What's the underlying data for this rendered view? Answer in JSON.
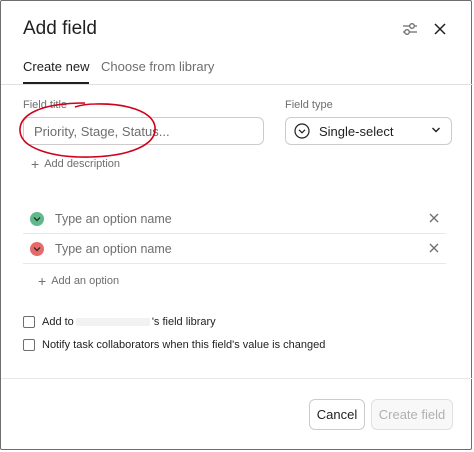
{
  "dialog": {
    "title": "Add field",
    "settings_icon": "sliders-icon",
    "close_icon": "close-icon"
  },
  "tabs": [
    {
      "label": "Create new",
      "active": true
    },
    {
      "label": "Choose from library",
      "active": false
    }
  ],
  "field_title": {
    "label": "Field title",
    "placeholder": "Priority, Stage, Status...",
    "value": ""
  },
  "add_description": "Add description",
  "field_type": {
    "label": "Field type",
    "value": "Single-select",
    "icon": "chevron-circle-icon"
  },
  "options": [
    {
      "placeholder": "Type an option name",
      "color": "#5fb989"
    },
    {
      "placeholder": "Type an option name",
      "color": "#e56b6b"
    }
  ],
  "add_option": "Add an option",
  "checkboxes": {
    "library_prefix": "Add to",
    "library_suffix": "'s field library",
    "notify": "Notify task collaborators when this field's value is changed"
  },
  "buttons": {
    "cancel": "Cancel",
    "create": "Create field"
  },
  "colors": {
    "annotation": "#d0021b",
    "text_primary": "#1e1f21",
    "text_secondary": "#6d6e6f"
  }
}
